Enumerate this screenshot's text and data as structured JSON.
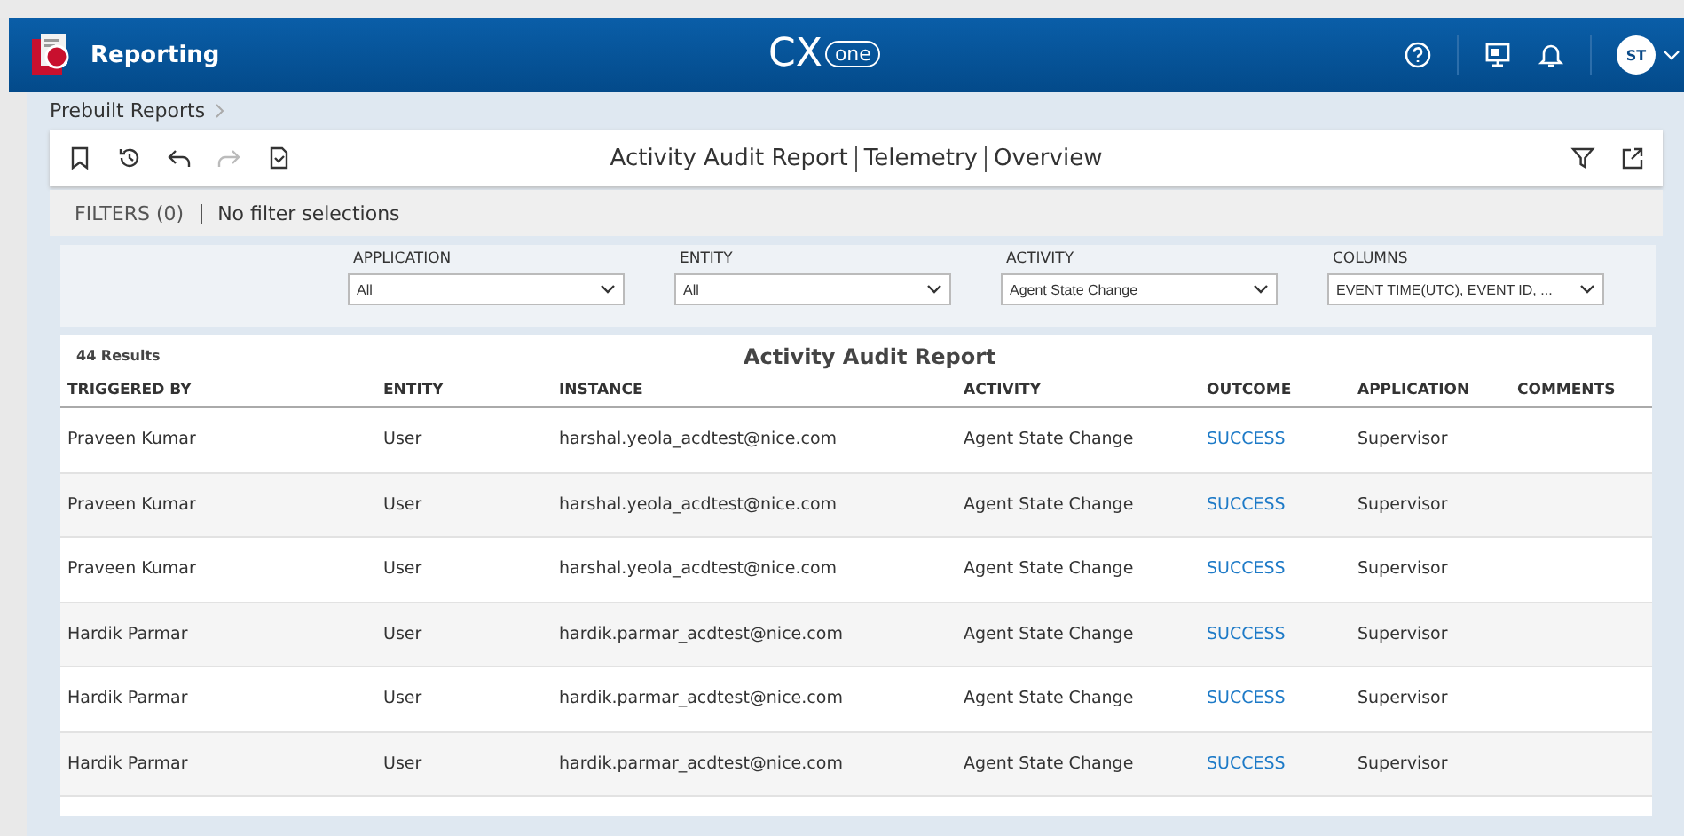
{
  "header": {
    "app_title": "Reporting",
    "logo_text": "CX",
    "logo_cloud_text": "one",
    "avatar": "ST"
  },
  "breadcrumb": [
    "Prebuilt Reports"
  ],
  "toolbar": {
    "title_parts": [
      "Activity Audit Report",
      "Telemetry",
      "Overview"
    ]
  },
  "filters_bar": {
    "label": "FILTERS (0)",
    "summary": "No filter selections"
  },
  "filters": [
    {
      "label": "APPLICATION",
      "value": "All"
    },
    {
      "label": "ENTITY",
      "value": "All"
    },
    {
      "label": "ACTIVITY",
      "value": "Agent State Change"
    },
    {
      "label": "COLUMNS",
      "value": "EVENT TIME(UTC), EVENT ID, ..."
    }
  ],
  "table": {
    "results": "44 Results",
    "title": "Activity Audit Report",
    "columns": [
      "TRIGGERED BY",
      "ENTITY",
      "INSTANCE",
      "ACTIVITY",
      "OUTCOME",
      "APPLICATION",
      "COMMENTS"
    ],
    "rows": [
      {
        "triggered_by": "Praveen Kumar",
        "entity": "User",
        "instance": "harshal.yeola_acdtest@nice.com",
        "activity": "Agent State Change",
        "outcome": "SUCCESS",
        "application": "Supervisor"
      },
      {
        "triggered_by": "Praveen Kumar",
        "entity": "User",
        "instance": "harshal.yeola_acdtest@nice.com",
        "activity": "Agent State Change",
        "outcome": "SUCCESS",
        "application": "Supervisor"
      },
      {
        "triggered_by": "Praveen Kumar",
        "entity": "User",
        "instance": "harshal.yeola_acdtest@nice.com",
        "activity": "Agent State Change",
        "outcome": "SUCCESS",
        "application": "Supervisor"
      },
      {
        "triggered_by": "Hardik Parmar",
        "entity": "User",
        "instance": "hardik.parmar_acdtest@nice.com",
        "activity": "Agent State Change",
        "outcome": "SUCCESS",
        "application": "Supervisor"
      },
      {
        "triggered_by": "Hardik Parmar",
        "entity": "User",
        "instance": "hardik.parmar_acdtest@nice.com",
        "activity": "Agent State Change",
        "outcome": "SUCCESS",
        "application": "Supervisor"
      },
      {
        "triggered_by": "Hardik Parmar",
        "entity": "User",
        "instance": "hardik.parmar_acdtest@nice.com",
        "activity": "Agent State Change",
        "outcome": "SUCCESS",
        "application": "Supervisor"
      }
    ]
  }
}
